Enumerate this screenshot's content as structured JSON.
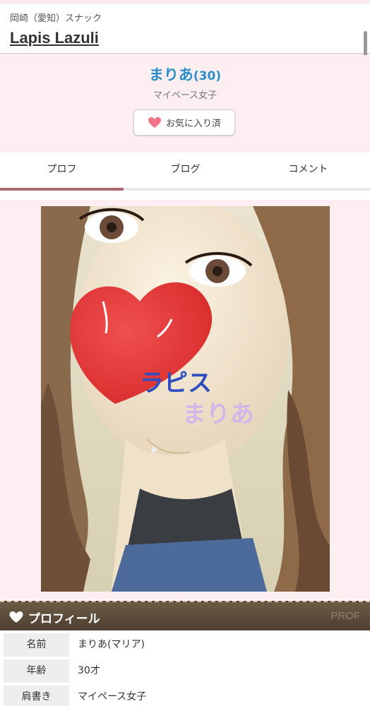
{
  "header": {
    "area_label": "岡崎（愛知）スナック",
    "shop_name": "Lapis Lazuli"
  },
  "profile_header": {
    "name": "まりあ",
    "age": "(30)",
    "catchphrase": "マイペース女子",
    "favorite_button_label": "お気に入り済"
  },
  "tabs": [
    {
      "label": "プロフ",
      "active": true
    },
    {
      "label": "ブログ",
      "active": false
    },
    {
      "label": "コメント",
      "active": false
    }
  ],
  "photo": {
    "overlay_text_1": "ラピス",
    "overlay_text_2": "まりあ"
  },
  "profile_section": {
    "title": "プロフィール",
    "title_en": "PROF",
    "rows": [
      {
        "key": "名前",
        "value": "まりあ(マリア)"
      },
      {
        "key": "年齢",
        "value": "30才"
      },
      {
        "key": "肩書き",
        "value": "マイペース女子"
      }
    ]
  },
  "colors": {
    "accent_pink_bg": "#fdeef1",
    "name_blue": "#2a8fc6",
    "tab_indicator": "#a8696f",
    "section_brown": "#5c4b3a",
    "heart_pink": "#f2748a"
  }
}
